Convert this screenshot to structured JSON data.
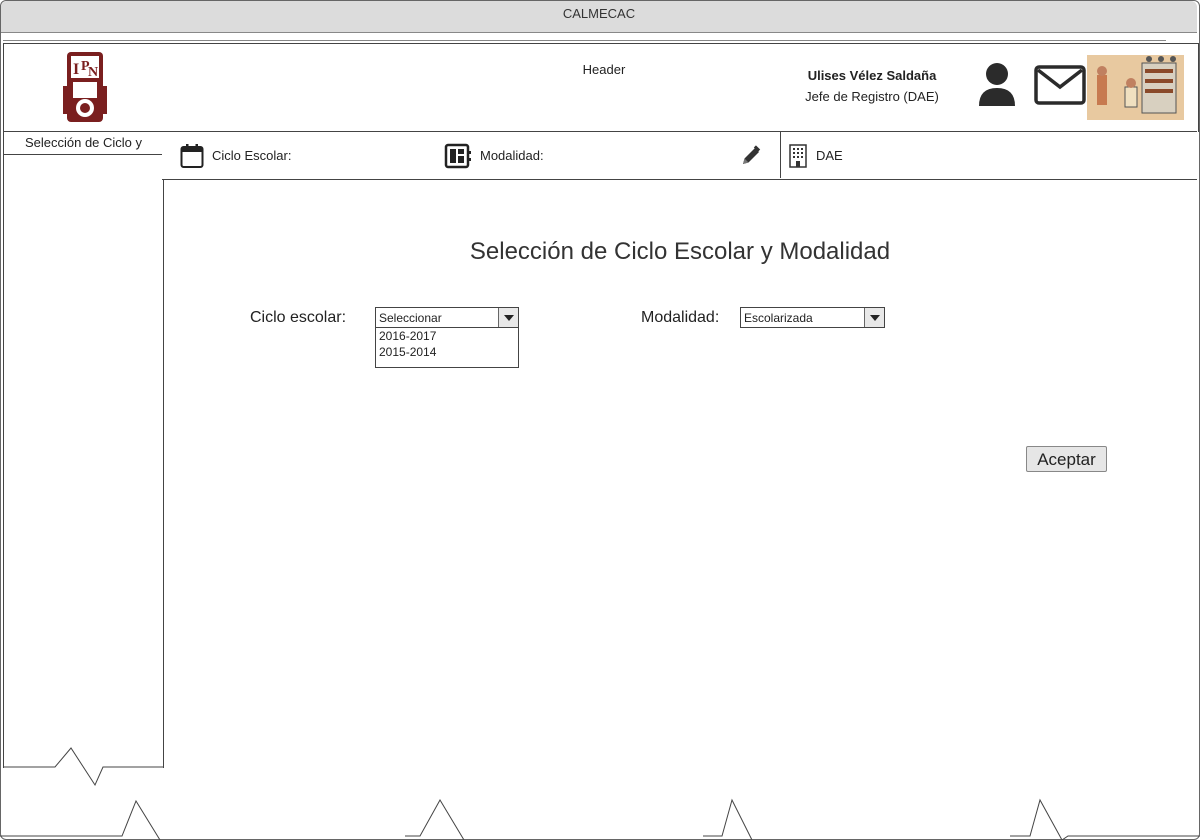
{
  "window": {
    "title": "CALMECAC"
  },
  "header": {
    "label": "Header",
    "user_name": "Ulises Vélez Saldaña",
    "user_role": "Jefe de Registro (DAE)"
  },
  "sidebar": {
    "title": "Selección de Ciclo y"
  },
  "topbar": {
    "ciclo_label": "Ciclo Escolar:",
    "modalidad_label": "Modalidad:",
    "dept_label": "DAE"
  },
  "main": {
    "title": "Selección de Ciclo Escolar y Modalidad",
    "ciclo_field_label": "Ciclo escolar:",
    "ciclo_select_value": "Seleccionar",
    "ciclo_options": [
      "2016-2017",
      "2015-2014"
    ],
    "modalidad_field_label": "Modalidad:",
    "modalidad_select_value": "Escolarizada",
    "accept_button": "Aceptar"
  },
  "icons": {
    "logo": "ipn-logo",
    "user": "user-icon",
    "mail": "mail-icon",
    "calendar": "calendar-icon",
    "modalidad": "dashboard-icon",
    "edit": "pencil-icon",
    "building": "building-icon"
  },
  "colors": {
    "logo": "#7a1f1f",
    "titlebar": "#dcdcdc"
  }
}
